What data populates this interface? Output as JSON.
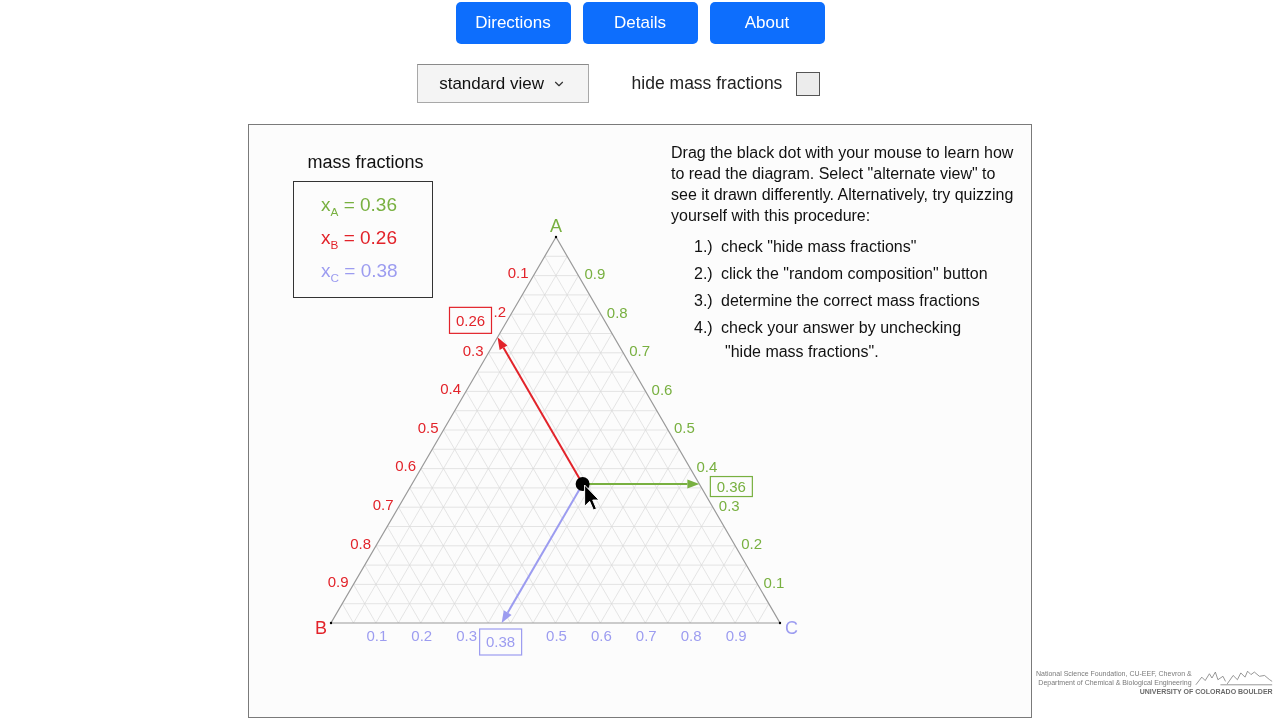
{
  "nav_buttons": [
    {
      "label": "Directions"
    },
    {
      "label": "Details"
    },
    {
      "label": "About"
    }
  ],
  "view_select": {
    "value": "standard view"
  },
  "hide_mass_fractions": {
    "label": "hide mass fractions",
    "checked": false
  },
  "legend": {
    "title": "mass fractions",
    "items": [
      {
        "text": "x$_{A}$ = 0.36",
        "color": "#78b040"
      },
      {
        "text": "x$_{B}$ = 0.26",
        "color": "#e2232a"
      },
      {
        "text": "x$_{C}$ = 0.38",
        "color": "#9c9cf0"
      }
    ]
  },
  "instructions": {
    "intro": "Drag the black dot with your mouse to learn how to read the diagram. Select \"alternate view\" to see it drawn differently. Alternatively, try quizzing yourself with this procedure:",
    "steps": [
      {
        "number": "1.)",
        "text": "check \"hide mass fractions\""
      },
      {
        "number": "2.)",
        "text": "click the \"random composition\" button"
      },
      {
        "number": "3.)",
        "text": "determine the correct mass fractions"
      },
      {
        "number": "4.)",
        "text": "check your answer by unchecking \"hide mass fractions\"."
      }
    ]
  },
  "diagram": {
    "axes": [
      {
        "vertex": "A",
        "color": "#78b040",
        "ticks": [
          "0.1",
          "0.2",
          "0.3",
          "0.4",
          "0.5",
          "0.6",
          "0.7",
          "0.8",
          "0.9"
        ],
        "readout": "0.36"
      },
      {
        "vertex": "B",
        "color": "#e2232a",
        "ticks": [
          "0.1",
          ".2",
          "0.3",
          "0.4",
          "0.5",
          "0.6",
          "0.7",
          "0.8",
          "0.9"
        ],
        "readout": "0.26"
      },
      {
        "vertex": "C",
        "color": "#9c9cf0",
        "ticks": [
          "0.1",
          "0.2",
          "0.3",
          "0.5",
          "0.6",
          "0.7",
          "0.8",
          "0.9"
        ],
        "readout": "0.38"
      }
    ]
  },
  "footer": {
    "credit_lines": [
      "National Science Foundation, CU-EEF, Chevron &",
      "Department of Chemical & Biological Engineering"
    ],
    "university": "UNIVERSITY OF COLORADO BOULDER"
  }
}
